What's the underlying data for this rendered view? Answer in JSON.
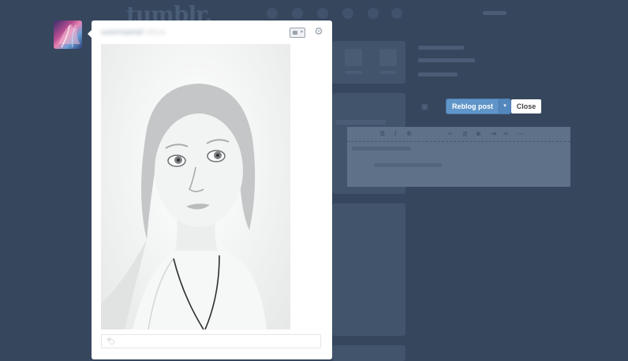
{
  "app": {
    "logo_text": "tumblr."
  },
  "post": {
    "blog_name": "username",
    "blog_suffix": "Follow"
  },
  "reblog": {
    "reblog_label": "Reblog post",
    "caret": "▾",
    "close_label": "Close",
    "toolbar": {
      "bold": "B",
      "italic": "I",
      "strike": "S",
      "more": "⋯"
    }
  },
  "tags": {
    "placeholder": "",
    "value": ""
  },
  "icons": {
    "tag": "tag-icon",
    "gear": "gear-icon",
    "photo_type": "photo-icon"
  },
  "colors": {
    "background": "#36465d",
    "reblog_button": "#5f95c8",
    "card": "#ffffff"
  }
}
